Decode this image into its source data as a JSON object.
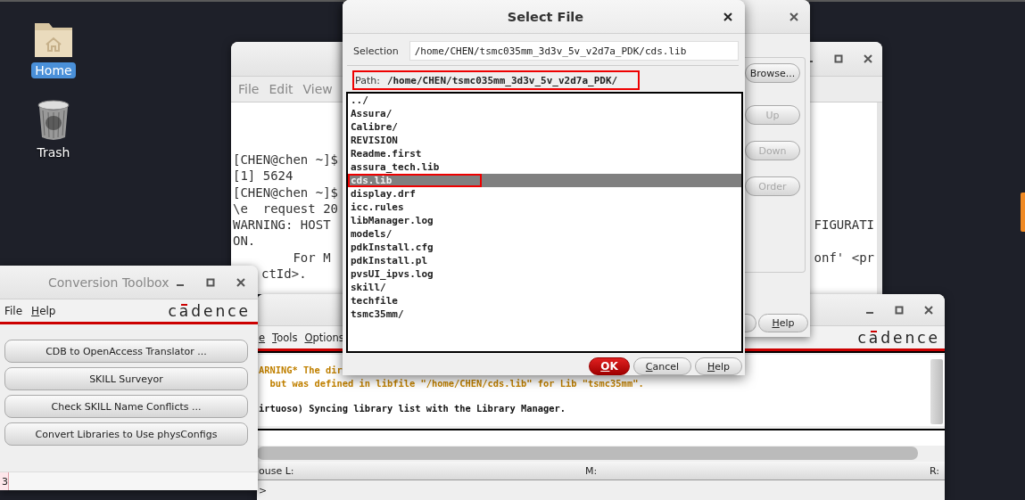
{
  "desktop": {
    "icons": [
      {
        "label": "Home",
        "kind": "folder",
        "selected": true
      },
      {
        "label": "Trash",
        "kind": "trash",
        "selected": false
      }
    ]
  },
  "terminal": {
    "menu": [
      "File",
      "Edit",
      "View"
    ],
    "lines": [
      {
        "text": "[CHEN@chen ~]$"
      },
      {
        "text": "[1] 5624"
      },
      {
        "text": "[CHEN@chen ~]$"
      },
      {
        "text": "\\e  request 20"
      },
      {
        "text": "WARNING: HOST ",
        "right": "FIGURATI"
      },
      {
        "text": "ON."
      },
      {
        "text": "        For M",
        "right": "onf' <pr"
      },
      {
        "text": "ctId>.",
        "kind": "cut"
      }
    ]
  },
  "library_editor": {
    "buttons": [
      {
        "label": "Browse...",
        "disabled": false
      },
      {
        "label": "Up",
        "disabled": true
      },
      {
        "label": "Down",
        "disabled": true
      },
      {
        "label": "Order",
        "disabled": true
      }
    ],
    "help": "Help"
  },
  "ciw": {
    "menu": [
      "e",
      "Tools",
      "Options"
    ],
    "logo": "cadence",
    "log": [
      {
        "text": "ARNING* The dir",
        "kind": "warning"
      },
      {
        "text": "  but was defined in libfile \"/home/CHEN/cds.lib\" for Lib \"tsmc35mm\".",
        "kind": "warning"
      },
      {
        "text": "irtuoso) Syncing library list with the Library Manager.",
        "kind": "info"
      }
    ],
    "status": {
      "left": "ouse L:",
      "middle": "M:",
      "right": "R:"
    },
    "prompt": ">"
  },
  "conversion_toolbox": {
    "title": "Conversion Toolbox",
    "menu": [
      "File",
      "Help"
    ],
    "logo": "cadence",
    "buttons": [
      "CDB to OpenAccess Translator ...",
      "SKILL Surveyor",
      "Check SKILL Name Conflicts ...",
      "Convert Libraries to Use physConfigs"
    ],
    "status": "3"
  },
  "select_file": {
    "title": "Select File",
    "selection_label": "Selection",
    "selection": "/home/CHEN/tsmc035mm_3d3v_5v_v2d7a_PDK/cds.lib",
    "path_label": "Path:",
    "path": "/home/CHEN/tsmc035mm_3d3v_5v_v2d7a_PDK/",
    "path_annotated": true,
    "files": [
      {
        "name": "../",
        "selected": false,
        "annotated": false
      },
      {
        "name": "Assura/",
        "selected": false,
        "annotated": false
      },
      {
        "name": "Calibre/",
        "selected": false,
        "annotated": false
      },
      {
        "name": "REVISION",
        "selected": false,
        "annotated": false
      },
      {
        "name": "Readme.first",
        "selected": false,
        "annotated": false
      },
      {
        "name": "assura_tech.lib",
        "selected": false,
        "annotated": false
      },
      {
        "name": "cds.lib",
        "selected": true,
        "annotated": true
      },
      {
        "name": "display.drf",
        "selected": false,
        "annotated": false
      },
      {
        "name": "icc.rules",
        "selected": false,
        "annotated": false
      },
      {
        "name": "libManager.log",
        "selected": false,
        "annotated": false
      },
      {
        "name": "models/",
        "selected": false,
        "annotated": false
      },
      {
        "name": "pdkInstall.cfg",
        "selected": false,
        "annotated": false
      },
      {
        "name": "pdkInstall.pl",
        "selected": false,
        "annotated": false
      },
      {
        "name": "pvsUI_ipvs.log",
        "selected": false,
        "annotated": false
      },
      {
        "name": "skill/",
        "selected": false,
        "annotated": false
      },
      {
        "name": "techfile",
        "selected": false,
        "annotated": false
      },
      {
        "name": "tsmc35mm/",
        "selected": false,
        "annotated": false
      }
    ],
    "buttons": [
      {
        "label": "OK",
        "kind": "default"
      },
      {
        "label": "Cancel",
        "kind": "normal"
      },
      {
        "label": "Help",
        "kind": "normal"
      }
    ]
  }
}
